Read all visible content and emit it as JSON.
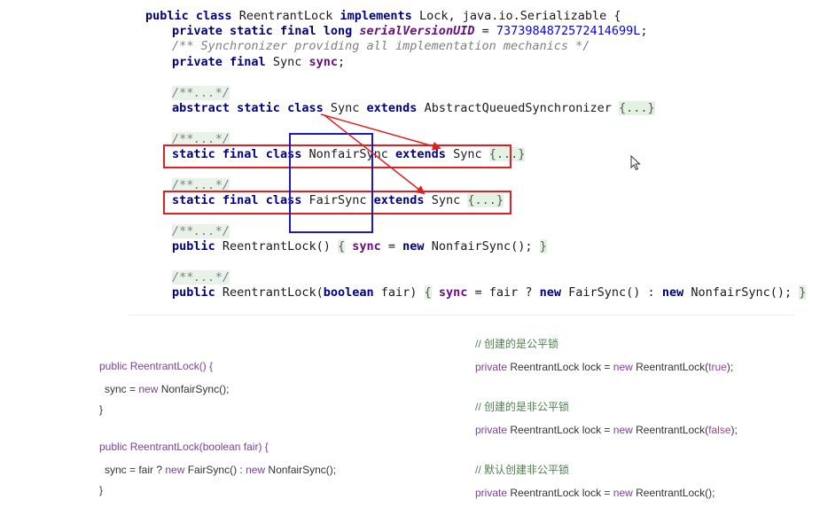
{
  "code": {
    "line_class_decl": [
      "public",
      "class",
      "ReentrantLock",
      "implements",
      "Lock, java.io.Serializable {"
    ],
    "line_uid": [
      "private",
      "static",
      "final",
      "long",
      "serialVersionUID",
      " = ",
      "7373984872572414699L",
      ";"
    ],
    "line_comment": "/** Synchronizer providing all implementation mechanics */",
    "line_sync_field": [
      "private",
      "final",
      "Sync",
      "sync",
      ";"
    ],
    "collapsed_doc": "/**...*/",
    "line_sync_class": [
      "abstract",
      "static",
      "class",
      "Sync",
      "extends",
      "AbstractQueuedSynchronizer",
      "{...}"
    ],
    "line_nonfair": [
      "static",
      "final",
      "class",
      "NonfairSync",
      "extends",
      "Sync",
      "{...}"
    ],
    "line_fair": [
      "static",
      "final",
      "class",
      "FairSync",
      "extends",
      "Sync",
      "{...}"
    ],
    "line_ctor1": [
      "public",
      "ReentrantLock()",
      "{",
      "sync",
      " = ",
      "new",
      "NonfairSync();",
      "}"
    ],
    "line_ctor2": [
      "public",
      "ReentrantLock(",
      "boolean",
      "fair)",
      "{",
      "sync",
      " = fair ? ",
      "new",
      "FairSync() : ",
      "new",
      "NonfairSync();",
      "}"
    ]
  },
  "simple_left": {
    "l1": [
      "public",
      "ReentrantLock() {"
    ],
    "l2": [
      "sync = ",
      "new",
      " NonfairSync();"
    ],
    "l3": "}",
    "l4": [
      "public",
      "ReentrantLock(boolean fair) {"
    ],
    "l5": [
      "sync = fair ? ",
      "new",
      " FairSync() : ",
      "new",
      " NonfairSync();"
    ],
    "l6": "}"
  },
  "simple_right": {
    "c1": "// 创建的是公平锁",
    "r1": [
      "private",
      " ReentrantLock lock = ",
      "new",
      " ReentrantLock(",
      "true",
      ");"
    ],
    "c2": "// 创建的是非公平锁",
    "r2": [
      "private",
      " ReentrantLock lock = ",
      "new",
      " ReentrantLock(",
      "false",
      ");"
    ],
    "c3": "// 默认创建非公平锁",
    "r3": [
      "private",
      " ReentrantLock lock = ",
      "new",
      " ReentrantLock();"
    ]
  },
  "annotation_colors": {
    "red": "#e02020",
    "blue": "#1a1acc"
  }
}
